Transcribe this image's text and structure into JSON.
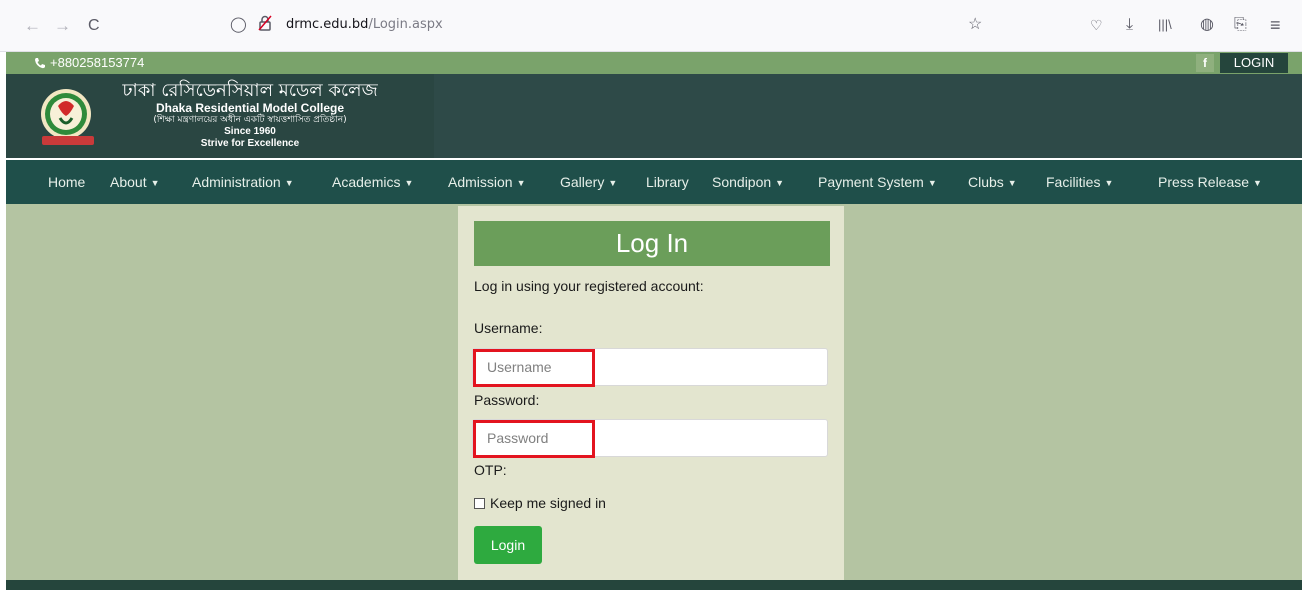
{
  "browser": {
    "url_domain": "drmc.edu.bd",
    "url_path": "/Login.aspx",
    "back_icon": "←",
    "forward_icon": "→",
    "reload_icon": "C",
    "shield_icon": "◯",
    "lock_icon": "🔒",
    "star_icon": "☆",
    "pocket_icon": "♡",
    "download_icon": "⤓",
    "library_icon": "|||\\",
    "globe_icon": "◍",
    "extension_icon": "⎘",
    "menu_icon": "≡"
  },
  "topbar": {
    "phone": "+880258153774",
    "facebook_label": "f",
    "login_label": "LOGIN"
  },
  "header": {
    "name_bn": "ঢাকা রেসিডেনসিয়াল মডেল কলেজ",
    "name_en": "Dhaka Residential Model College",
    "subtitle_bn": "(শিক্ষা মন্ত্রণালয়ের অধীন একটি স্বায়ত্তশাসিত প্রতিষ্ঠান)",
    "since": "Since 1960",
    "motto": "Strive for Excellence"
  },
  "nav": {
    "items": [
      {
        "label": "Home",
        "dropdown": false
      },
      {
        "label": "About",
        "dropdown": true
      },
      {
        "label": "Administration",
        "dropdown": true
      },
      {
        "label": "Academics",
        "dropdown": true
      },
      {
        "label": "Admission",
        "dropdown": true
      },
      {
        "label": "Gallery",
        "dropdown": true
      },
      {
        "label": "Library",
        "dropdown": false
      },
      {
        "label": "Sondipon",
        "dropdown": true
      },
      {
        "label": "Payment System",
        "dropdown": true
      },
      {
        "label": "Clubs",
        "dropdown": true
      },
      {
        "label": "Facilities",
        "dropdown": true
      },
      {
        "label": "Press Release",
        "dropdown": true
      }
    ],
    "chevron": "❯"
  },
  "login": {
    "title": "Log In",
    "intro": "Log in using your registered account:",
    "username_label": "Username:",
    "username_placeholder": "Username",
    "password_label": "Password:",
    "password_placeholder": "Password",
    "otp_label": "OTP:",
    "keep_signed_in": "Keep me signed in",
    "button": "Login"
  },
  "colors": {
    "topbar": "#7aa36b",
    "header": "#2e4a48",
    "navbar": "#1f4f4a",
    "content_bg": "#b4c4a2",
    "panel_bg": "#e3e5cf",
    "title_bg": "#6b9e5a",
    "button_bg": "#2eaa3f",
    "highlight": "#e3141f"
  }
}
